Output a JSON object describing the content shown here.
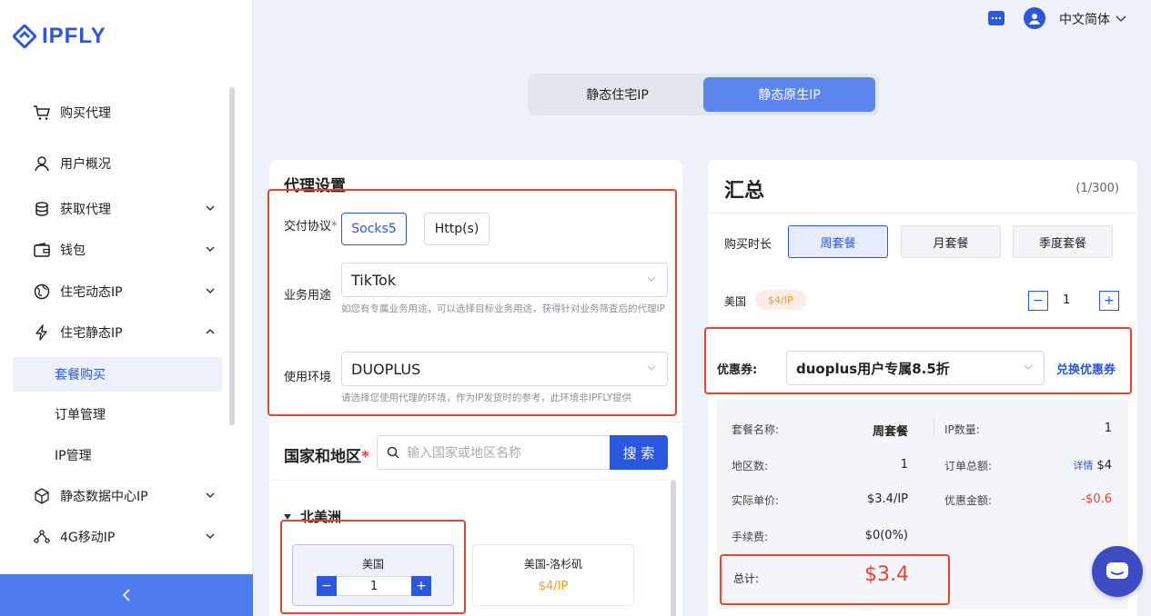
{
  "brand": {
    "name": "IPFLY",
    "color": "#2a56e0"
  },
  "topbar": {
    "language": "中文简体"
  },
  "sidebar": {
    "items": [
      {
        "label": "购买代理",
        "icon": "cart-icon",
        "expandable": false
      },
      {
        "label": "用户概况",
        "icon": "user-icon",
        "expandable": false
      },
      {
        "label": "获取代理",
        "icon": "database-icon",
        "expandable": true
      },
      {
        "label": "钱包",
        "icon": "wallet-icon",
        "expandable": true
      },
      {
        "label": "住宅动态IP",
        "icon": "globe-icon",
        "expandable": true
      },
      {
        "label": "住宅静态IP",
        "icon": "lightning-icon",
        "expandable": true,
        "expanded": true
      },
      {
        "label": "静态数据中心IP",
        "icon": "cube-icon",
        "expandable": true
      },
      {
        "label": "4G移动IP",
        "icon": "network-icon",
        "expandable": true
      }
    ],
    "subitems": [
      {
        "label": "套餐购买",
        "active": true
      },
      {
        "label": "订单管理",
        "active": false
      },
      {
        "label": "IP管理",
        "active": false
      }
    ]
  },
  "tabs": [
    {
      "label": "静态住宅IP",
      "active": false
    },
    {
      "label": "静态原生IP",
      "active": true
    }
  ],
  "proxy_settings": {
    "title": "代理设置",
    "protocol_label": "交付协议",
    "protocols": [
      "Socks5",
      "Http(s)"
    ],
    "selected_protocol": "Socks5",
    "usage_label": "业务用途",
    "usage_value": "TikTok",
    "usage_hint": "如您有专属业务用途，可以选择目标业务用途，获得针对业务筛查后的代理IP",
    "env_label": "使用环境",
    "env_value": "DUOPLUS",
    "env_hint": "请选择您使用代理的环境，作为IP发货时的参考，此环境非IPFLY提供"
  },
  "region": {
    "title": "国家和地区",
    "search_placeholder": "输入国家或地区名称",
    "search_button": "搜 索",
    "continent": "北美洲",
    "countries": [
      {
        "name": "美国",
        "quantity": "1"
      },
      {
        "name": "美国-洛杉矶",
        "price": "$4/IP"
      }
    ]
  },
  "summary": {
    "title": "汇总",
    "count": "(1/300)",
    "duration_label": "购买时长",
    "durations": [
      {
        "label": "周套餐",
        "active": true
      },
      {
        "label": "月套餐",
        "active": false
      },
      {
        "label": "季度套餐",
        "active": false
      }
    ],
    "country": "美国",
    "country_price": "$4/IP",
    "quantity": "1",
    "coupon_label": "优惠券:",
    "coupon_value": "duoplus用户专属8.5折",
    "coupon_link": "兑换优惠券",
    "details": {
      "package_label": "套餐名称:",
      "package_value": "周套餐",
      "ip_count_label": "IP数量:",
      "ip_count_value": "1",
      "regions_label": "地区数:",
      "regions_value": "1",
      "order_total_label": "订单总额:",
      "order_total_link": "详情",
      "order_total_value": "$4",
      "unit_price_label": "实际单价:",
      "unit_price_value": "$3.4/IP",
      "discount_label": "优惠金额:",
      "discount_value": "-$0.6",
      "fee_label": "手续费:",
      "fee_value": "$0(0%)",
      "total_label": "总计:",
      "total_value": "$3.4"
    }
  },
  "colors": {
    "accent": "#2a56e0",
    "highlight_red": "#e4452f",
    "price_orange": "#f0a020"
  }
}
